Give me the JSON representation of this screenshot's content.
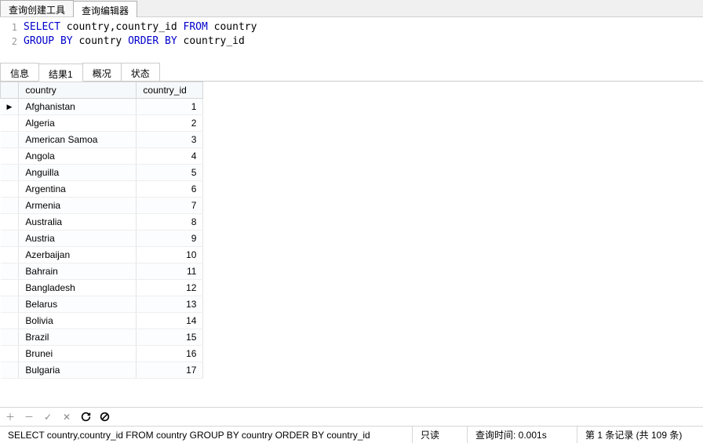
{
  "topTabs": {
    "items": [
      {
        "label": "查询创建工具"
      },
      {
        "label": "查询编辑器"
      }
    ],
    "activeIndex": 1
  },
  "sql": {
    "lines": [
      {
        "n": "1",
        "tokens": [
          {
            "t": "kw",
            "v": "SELECT"
          },
          {
            "t": "plain",
            "v": " country,country_id "
          },
          {
            "t": "kw",
            "v": "FROM"
          },
          {
            "t": "plain",
            "v": " country"
          }
        ]
      },
      {
        "n": "2",
        "tokens": [
          {
            "t": "kw",
            "v": "GROUP"
          },
          {
            "t": "plain",
            "v": " "
          },
          {
            "t": "kw",
            "v": "BY"
          },
          {
            "t": "plain",
            "v": " country "
          },
          {
            "t": "kw",
            "v": "ORDER"
          },
          {
            "t": "plain",
            "v": " "
          },
          {
            "t": "kw",
            "v": "BY"
          },
          {
            "t": "plain",
            "v": " country_id"
          }
        ]
      }
    ]
  },
  "resultTabs": {
    "items": [
      {
        "label": "信息"
      },
      {
        "label": "结果1"
      },
      {
        "label": "概况"
      },
      {
        "label": "状态"
      }
    ],
    "activeIndex": 1
  },
  "grid": {
    "columns": [
      "country",
      "country_id"
    ],
    "selectedRow": 0,
    "rows": [
      {
        "country": "Afghanistan",
        "country_id": 1
      },
      {
        "country": "Algeria",
        "country_id": 2
      },
      {
        "country": "American Samoa",
        "country_id": 3
      },
      {
        "country": "Angola",
        "country_id": 4
      },
      {
        "country": "Anguilla",
        "country_id": 5
      },
      {
        "country": "Argentina",
        "country_id": 6
      },
      {
        "country": "Armenia",
        "country_id": 7
      },
      {
        "country": "Australia",
        "country_id": 8
      },
      {
        "country": "Austria",
        "country_id": 9
      },
      {
        "country": "Azerbaijan",
        "country_id": 10
      },
      {
        "country": "Bahrain",
        "country_id": 11
      },
      {
        "country": "Bangladesh",
        "country_id": 12
      },
      {
        "country": "Belarus",
        "country_id": 13
      },
      {
        "country": "Bolivia",
        "country_id": 14
      },
      {
        "country": "Brazil",
        "country_id": 15
      },
      {
        "country": "Brunei",
        "country_id": 16
      },
      {
        "country": "Bulgaria",
        "country_id": 17
      }
    ]
  },
  "toolbar": {
    "icons": {
      "add": "＋",
      "remove": "－",
      "confirm": "✓",
      "cancel": "✕",
      "refresh": "↻",
      "stop": "⃠"
    }
  },
  "status": {
    "query": "SELECT country,country_id FROM country  GROUP BY country ORDER BY country_id",
    "mode": "只读",
    "timeLabel": "查询时间: 0.001s",
    "recordLabel": "第 1 条记录 (共 109 条)"
  }
}
